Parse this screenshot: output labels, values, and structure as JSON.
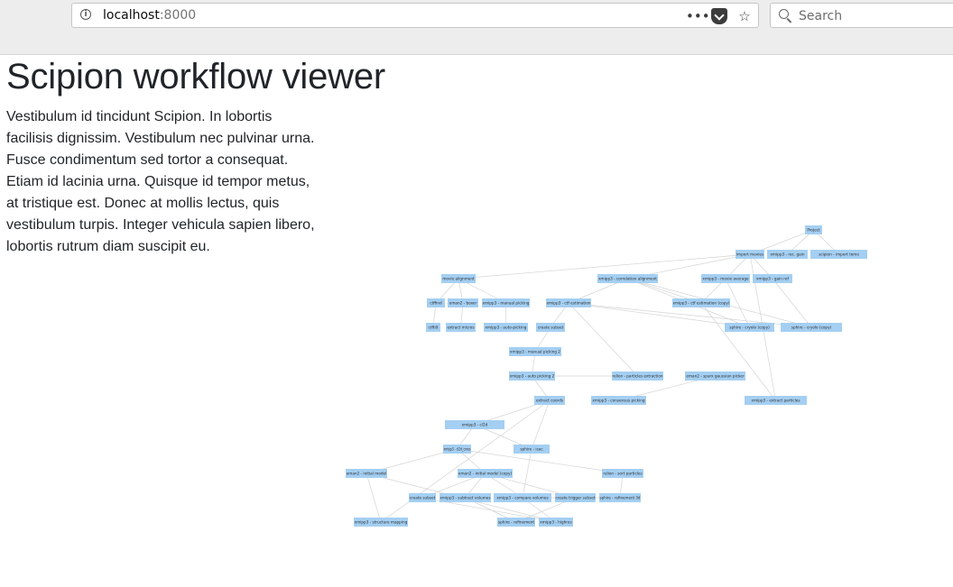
{
  "browser": {
    "url_host": "localhost",
    "url_port": ":8000",
    "search_placeholder": "Search"
  },
  "page": {
    "title": "Scipion workflow viewer",
    "intro": "Vestibulum id tincidunt Scipion. In lobortis facilisis dignissim. Vestibulum nec pulvinar urna. Fusce condimentum sed tortor a consequat. Etiam id lacinia urna. Quisque id tempor metus, at tristique est. Donec at mollis lectus, quis vestibulum turpis. Integer vehicula sapien libero, lobortis rutrum diam suscipit eu."
  },
  "graph": {
    "node_color": "#a4cff2",
    "nodes": [
      {
        "id": "project",
        "label": "Project"
      },
      {
        "id": "import_movies",
        "label": "import movies"
      },
      {
        "id": "rec_gain",
        "label": "xmipp3 - rec. gain"
      },
      {
        "id": "import_tomo",
        "label": "scipion - import tomo"
      },
      {
        "id": "movie_align",
        "label": "movie alignment"
      },
      {
        "id": "xmipp_corr_align",
        "label": "xmipp3 - correlation alignment"
      },
      {
        "id": "movie_avg",
        "label": "xmipp3 - movie average"
      },
      {
        "id": "gainref",
        "label": "xmipp3 - gain ref"
      },
      {
        "id": "ctffind",
        "label": "ctffind"
      },
      {
        "id": "eman_boxer",
        "label": "eman2 - boxer"
      },
      {
        "id": "manual_pick",
        "label": "xmipp3 - manual picking"
      },
      {
        "id": "ctf_est",
        "label": "xmipp3 - ctf estimation"
      },
      {
        "id": "ctf_est_copy",
        "label": "xmipp3 - ctf estimation (copy)"
      },
      {
        "id": "ctftilt",
        "label": "ctftilt"
      },
      {
        "id": "extract_micro",
        "label": "extract micros"
      },
      {
        "id": "auto_pick",
        "label": "xmipp3 - auto-picking"
      },
      {
        "id": "create_subset",
        "label": "create subset"
      },
      {
        "id": "cryolo",
        "label": "sphire - cryolo (copy)"
      },
      {
        "id": "cryolo_copy",
        "label": "sphire - cryolo (copy)"
      },
      {
        "id": "manual_pick2",
        "label": "xmipp3 - manual picking 2"
      },
      {
        "id": "auto_pick2",
        "label": "xmipp3 - auto picking 2"
      },
      {
        "id": "relion_extract",
        "label": "relion - particles extraction"
      },
      {
        "id": "gauss_pick",
        "label": "eman2 - sparx gaussian picker"
      },
      {
        "id": "extract_coords",
        "label": "extract coords"
      },
      {
        "id": "consensus",
        "label": "xmipp3 - consensus picking"
      },
      {
        "id": "extract_particles",
        "label": "xmipp3 - extract particles"
      },
      {
        "id": "cl2d",
        "label": "xmipp3 - cl2d"
      },
      {
        "id": "cl2d_cores",
        "label": "xmipp3 - cl2d_cores"
      },
      {
        "id": "sphire_isac",
        "label": "sphire - isac"
      },
      {
        "id": "eman_initial",
        "label": "eman2 - initial model"
      },
      {
        "id": "initial_copy",
        "label": "eman2 - initial model (copy)"
      },
      {
        "id": "relion_sort",
        "label": "relion - sort particles"
      },
      {
        "id": "create_subset2",
        "label": "create subset"
      },
      {
        "id": "subtract_vol",
        "label": "xmipp3 - subtract volumes"
      },
      {
        "id": "compare_vol",
        "label": "xmipp3 - compare volumes"
      },
      {
        "id": "create_trigger",
        "label": "create trigger subset"
      },
      {
        "id": "sphire_ref",
        "label": "sphire - refinement 3d"
      },
      {
        "id": "struct_map",
        "label": "xmipp3 - structure mapping"
      },
      {
        "id": "sphire_ref2",
        "label": "sphire - refinement"
      },
      {
        "id": "highres",
        "label": "xmipp3 - highres"
      }
    ]
  }
}
